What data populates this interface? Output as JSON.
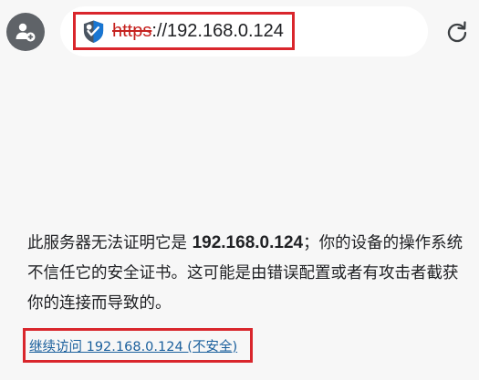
{
  "toolbar": {
    "profile_icon": "incognito-profile-icon",
    "security_icon": "shield-warning-icon",
    "url_scheme": "https",
    "url_rest": "://192.168.0.124",
    "reload_icon": "reload-icon"
  },
  "error": {
    "sentence_1_start": "此服务器无法证明它是",
    "host": "192.168.0.124",
    "sentence_1_end": "；你的设备的操作系统不信任它的安全证书。这可能是由错误配置或者有攻击者截获你的连接而导致的。",
    "continue_label": "继续访问 192.168.0.124 (不安全)"
  },
  "colors": {
    "background": "#f7f7f7",
    "omnibox": "#ffffff",
    "highlight_border": "#d9262c",
    "scheme_red": "#c5221f",
    "link_blue": "#1a5f9c",
    "shield_blue": "#1976d2",
    "shield_gray": "#4a5562"
  }
}
